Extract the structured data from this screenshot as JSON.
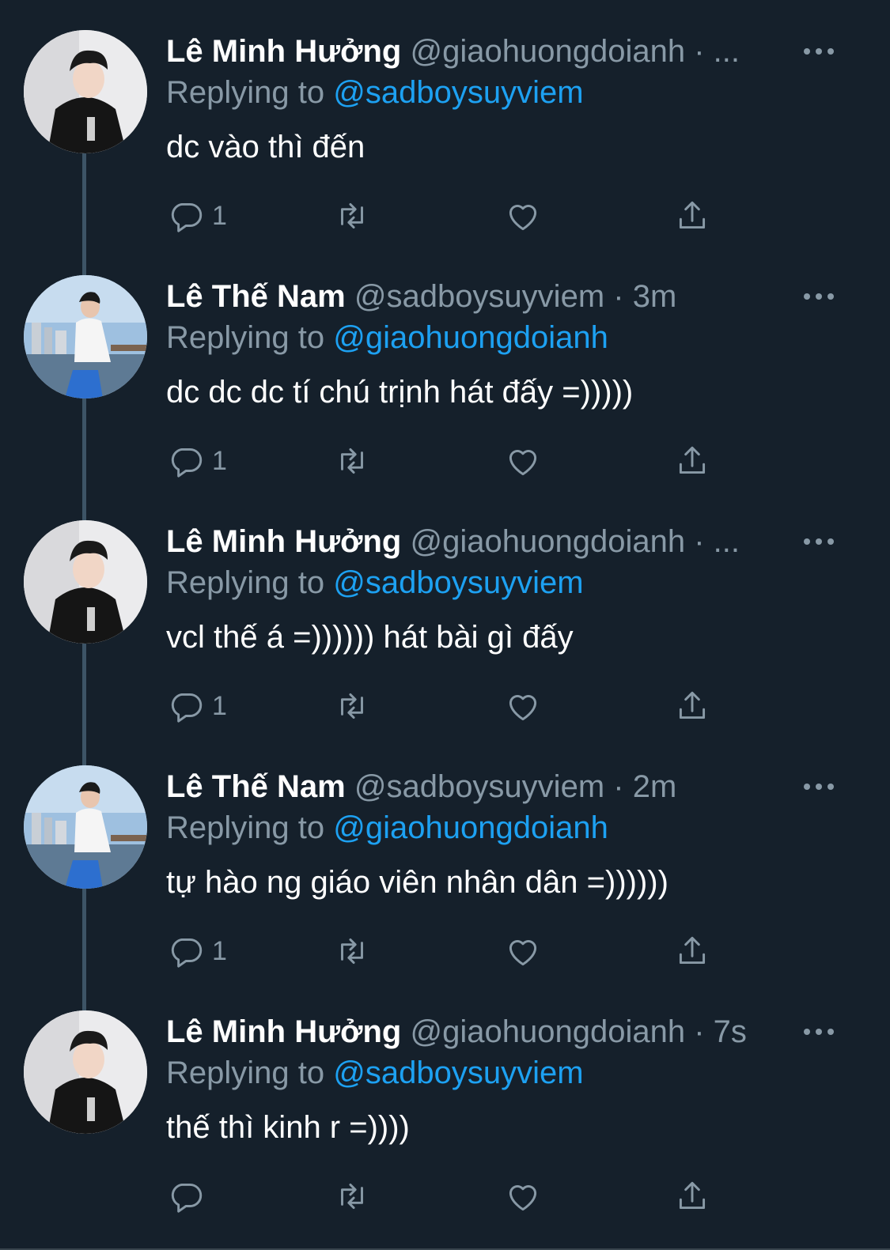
{
  "thread": {
    "tweets": [
      {
        "name": "Lê Minh Hưởng",
        "handle": "@giaohuongdoianh",
        "separator": "·",
        "time": "...",
        "reply_prefix": "Replying to",
        "reply_to": "@sadboysuyviem",
        "text": "dc vào thì đến",
        "reply_count": "1",
        "avatar": "avatar-black-hoodie"
      },
      {
        "name": "Lê Thế Nam",
        "handle": "@sadboysuyviem",
        "separator": "·",
        "time": "3m",
        "reply_prefix": "Replying to",
        "reply_to": "@giaohuongdoianh",
        "text": "dc dc dc tí chú trịnh hát đấy =)))))",
        "reply_count": "1",
        "avatar": "avatar-boat-city"
      },
      {
        "name": "Lê Minh Hưởng",
        "handle": "@giaohuongdoianh",
        "separator": "·",
        "time": "...",
        "reply_prefix": "Replying to",
        "reply_to": "@sadboysuyviem",
        "text": "vcl thế á =)))))) hát bài gì đấy",
        "reply_count": "1",
        "avatar": "avatar-black-hoodie"
      },
      {
        "name": "Lê Thế Nam",
        "handle": "@sadboysuyviem",
        "separator": "·",
        "time": "2m",
        "reply_prefix": "Replying to",
        "reply_to": "@giaohuongdoianh",
        "text": "tự hào ng giáo viên nhân dân =))))))",
        "reply_count": "1",
        "avatar": "avatar-boat-city"
      },
      {
        "name": "Lê Minh Hưởng",
        "handle": "@giaohuongdoianh",
        "separator": "·",
        "time": "7s",
        "reply_prefix": "Replying to",
        "reply_to": "@sadboysuyviem",
        "text": "thế thì kinh r =))))",
        "reply_count": "",
        "avatar": "avatar-black-hoodie"
      }
    ]
  },
  "icons": {
    "reply": "reply-icon",
    "retweet": "retweet-icon",
    "like": "heart-icon",
    "share": "share-icon",
    "more": "more-icon"
  },
  "colors": {
    "background": "#15202b",
    "secondary_text": "#8899a6",
    "link": "#1da1f2",
    "thread_line": "#3d5466"
  }
}
